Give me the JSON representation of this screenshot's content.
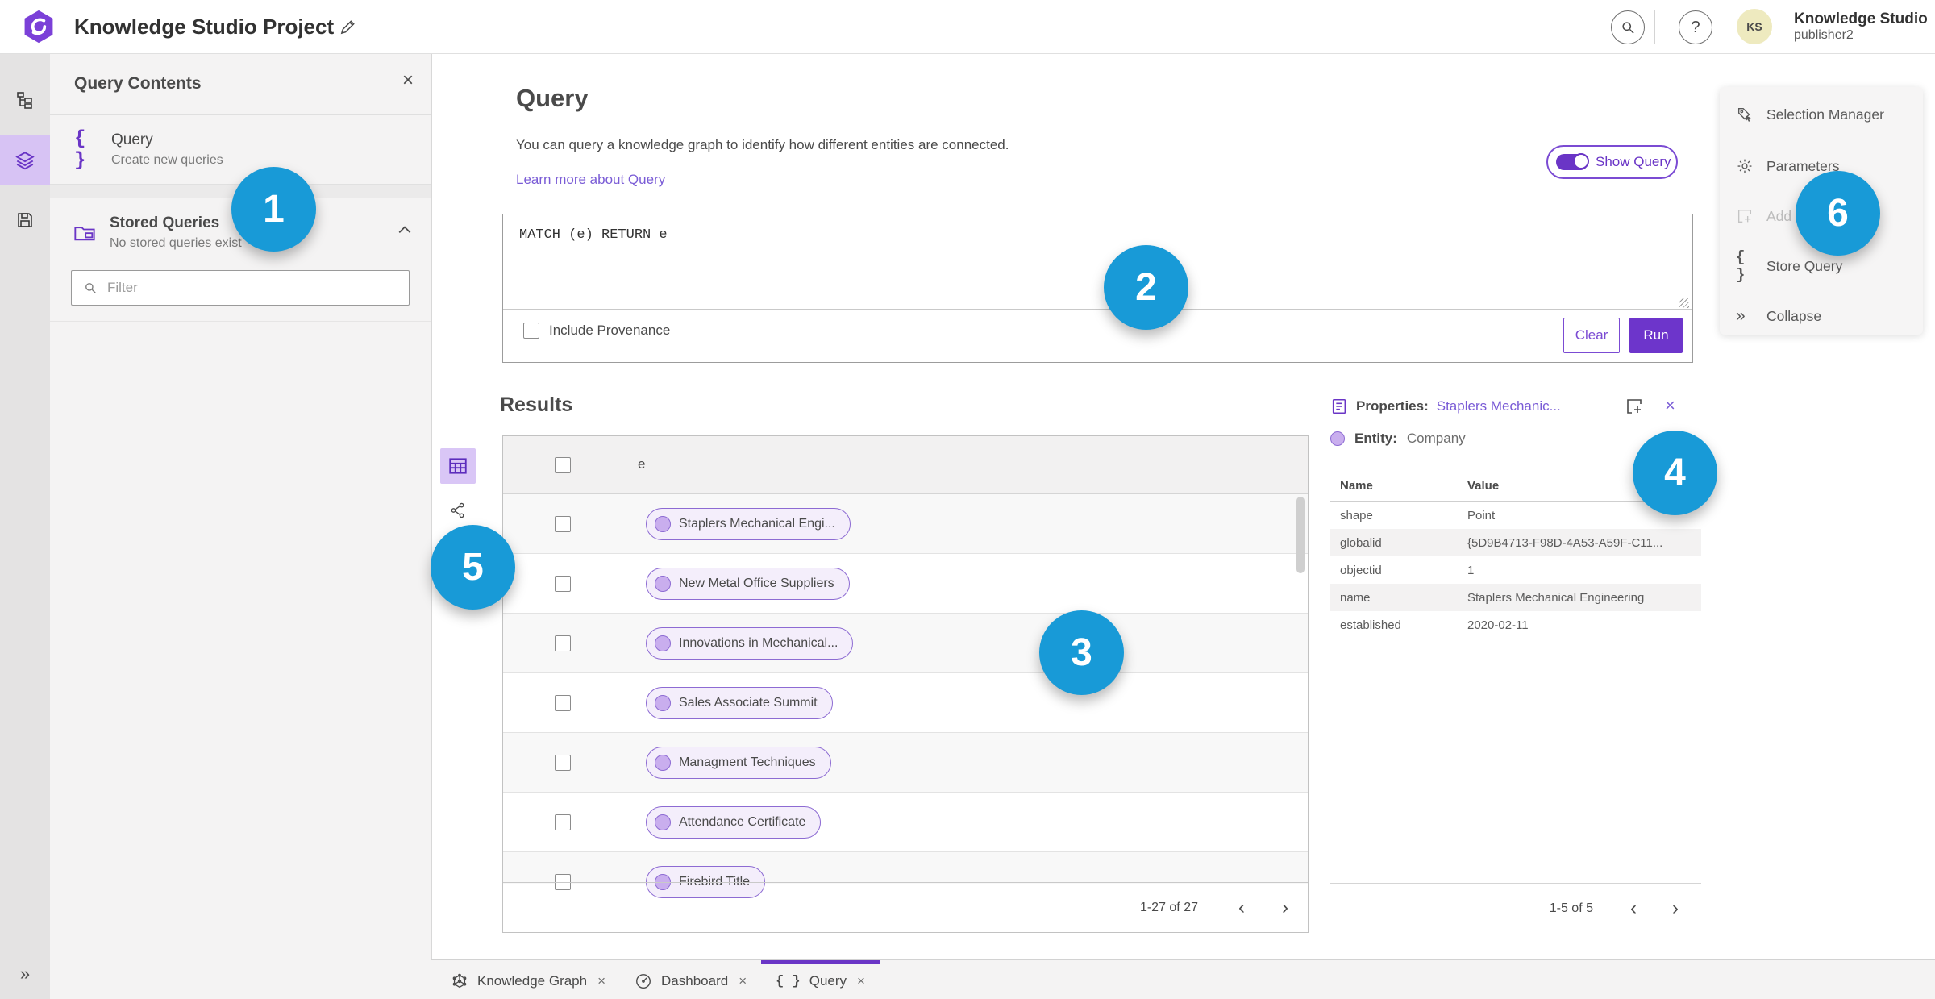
{
  "colors": {
    "accent_purple": "#6a35c6",
    "link_purple": "#7a5cd6",
    "annotation_blue": "#189ad7",
    "entity_pill_fill": "#f4eefb",
    "entity_pill_border": "#8d6bd3",
    "run_button": "#6d35cb"
  },
  "icons": {
    "close": "×",
    "prev": "‹",
    "next": "›",
    "collapse_double": "»",
    "braces": "{ }",
    "chevron_up_name": "chevron-up-icon"
  },
  "header": {
    "title": "Knowledge Studio Project",
    "user_name": "Knowledge Studio",
    "user_role": "publisher2",
    "avatar_initials": "KS"
  },
  "left_panel": {
    "title": "Query Contents",
    "query_item": {
      "label": "Query",
      "sublabel": "Create new queries"
    },
    "stored_item": {
      "label": "Stored Queries",
      "sublabel": "No stored queries exist"
    },
    "filter_placeholder": "Filter"
  },
  "query_section": {
    "title": "Query",
    "description": "You can query a knowledge graph to identify how different entities are connected.",
    "learn_more": "Learn more about Query",
    "show_query_label": "Show Query",
    "query_text": "MATCH (e) RETURN e",
    "include_provenance_label": "Include Provenance",
    "clear_label": "Clear",
    "run_label": "Run"
  },
  "results": {
    "title": "Results",
    "column_header": "e",
    "rows": [
      "Staplers Mechanical Engi...",
      "New Metal Office Suppliers",
      "Innovations in Mechanical...",
      "Sales Associate Summit",
      "Managment Techniques",
      "Attendance Certificate",
      "Firebird Title"
    ],
    "pagination": "1-27 of 27"
  },
  "properties_panel": {
    "title": "Properties:",
    "entity_link": "Staplers Mechanic...",
    "entity_label": "Entity:",
    "entity_type": "Company",
    "col_name": "Name",
    "col_value": "Value",
    "rows": [
      {
        "name": "shape",
        "value": "Point"
      },
      {
        "name": "globalid",
        "value": "{5D9B4713-F98D-4A53-A59F-C11..."
      },
      {
        "name": "objectid",
        "value": "1"
      },
      {
        "name": "name",
        "value": "Staplers Mechanical Engineering"
      },
      {
        "name": "established",
        "value": "2020-02-11"
      }
    ],
    "pagination": "1-5 of 5"
  },
  "right_menu": {
    "items": [
      {
        "label": "Selection Manager",
        "icon": "selection-manager-icon",
        "disabled": false
      },
      {
        "label": "Parameters",
        "icon": "gear-icon",
        "disabled": false
      },
      {
        "label": "Add",
        "icon": "add-square-icon",
        "disabled": true
      },
      {
        "label": "Store Query",
        "icon": "braces-icon",
        "disabled": false
      },
      {
        "label": "Collapse",
        "icon": "chevrons-right-icon",
        "disabled": false
      }
    ]
  },
  "bottom_tabs": [
    {
      "label": "Knowledge Graph",
      "icon": "knowledge-graph-icon",
      "active": false
    },
    {
      "label": "Dashboard",
      "icon": "dashboard-gauge-icon",
      "active": false
    },
    {
      "label": "Query",
      "icon": "braces-icon",
      "active": true
    }
  ],
  "annotations": [
    "1",
    "2",
    "3",
    "4",
    "5",
    "6"
  ]
}
